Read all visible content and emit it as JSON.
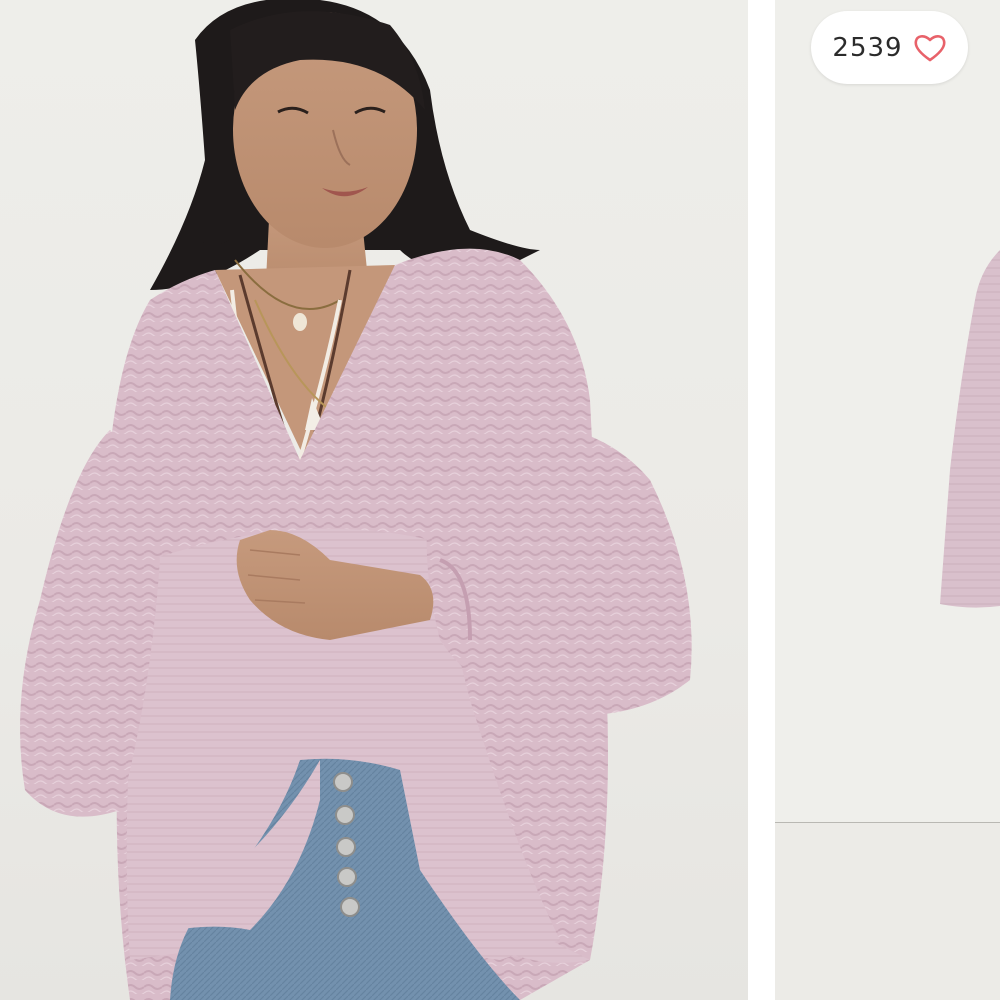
{
  "likes": {
    "count": "2539",
    "icon": "heart-outline-icon",
    "icon_color": "#e8626a"
  },
  "gallery": {
    "main_image": {
      "subject": "model-wearing-pink-peasant-top",
      "garment_color": "#dcbfcc",
      "jeans_color": "#6f8fae",
      "background_color": "#ecebe7"
    },
    "next_image": {
      "subject": "pink-top-flat-partial",
      "garment_color": "#d9bfcb",
      "background_color": "#efefeb"
    }
  }
}
